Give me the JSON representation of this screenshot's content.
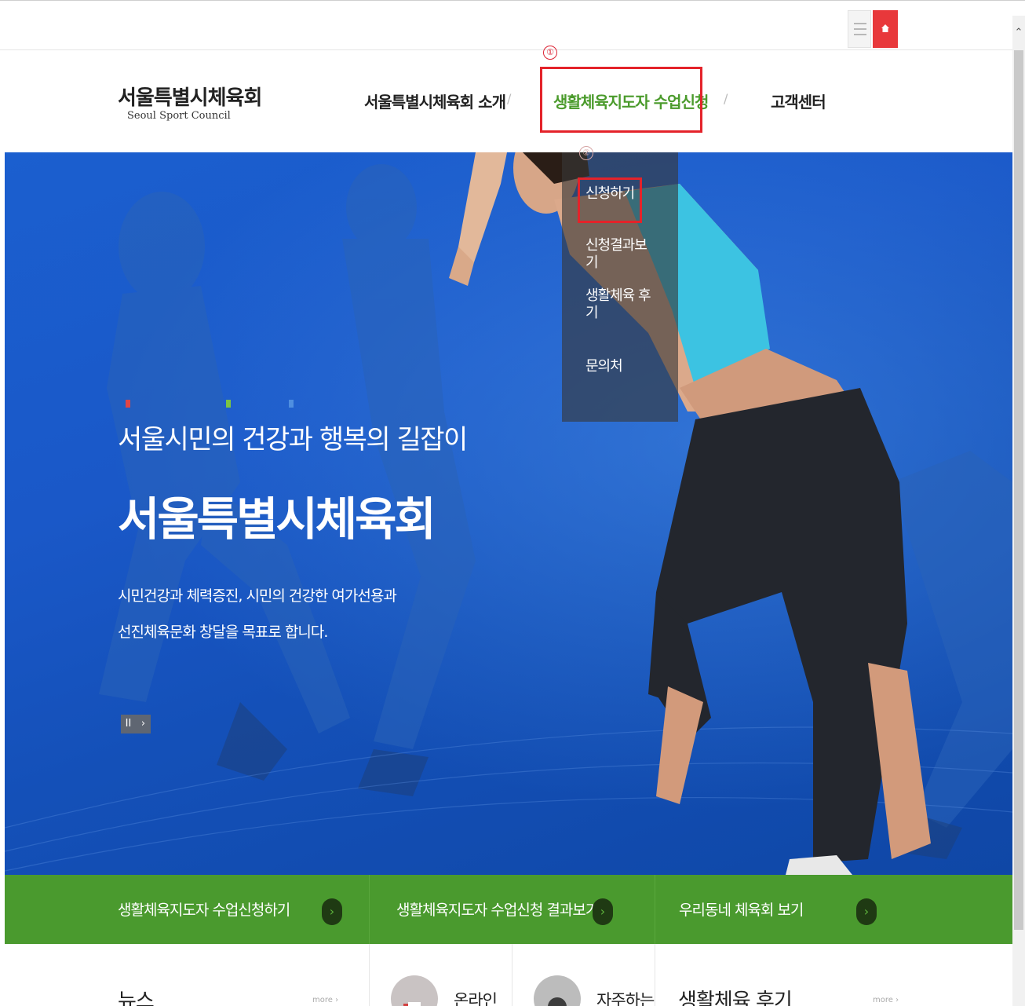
{
  "header": {
    "logo_ko": "서울특별시체육회",
    "logo_en": "Seoul Sport Council",
    "nav": [
      {
        "label": "서울특별시체육회 소개"
      },
      {
        "label": "생활체육지도자 수업신청"
      },
      {
        "label": "고객센터"
      }
    ],
    "separator": "/",
    "annotation_1": "①",
    "annotation_2": "②"
  },
  "topbar": {
    "menu_icon": "hamburger-icon",
    "home_icon": "home-icon",
    "home_color": "#e8383b"
  },
  "dropdown": {
    "items": [
      "신청하기",
      "신청결과보기",
      "생활체육 후기",
      "문의처"
    ]
  },
  "hero": {
    "subtitle": "서울시민의 건강과 행복의 길잡이",
    "title": "서울특별시체육회",
    "desc_line1": "시민건강과 체력증진, 시민의 건강한 여가선용과",
    "desc_line2": "선진체육문화 창달을 목표로 합니다.",
    "pause": "II",
    "next": "›"
  },
  "quickbar": {
    "items": [
      {
        "label": "생활체육지도자 수업신청하기"
      },
      {
        "label": "생활체육지도자 수업신청 결과보기"
      },
      {
        "label": "우리동네 체육회 보기"
      }
    ],
    "arrow": "›",
    "color": "#4a9a2e"
  },
  "bottom": {
    "news_title": "뉴스",
    "more": "more ›",
    "online_label": "온라인",
    "faq_label": "자주하는",
    "review_title": "생활체육 후기"
  },
  "colors": {
    "accent_green": "#4b9b2c",
    "annotation_red": "#e4232a",
    "hero_blue": "#1a58c8"
  }
}
